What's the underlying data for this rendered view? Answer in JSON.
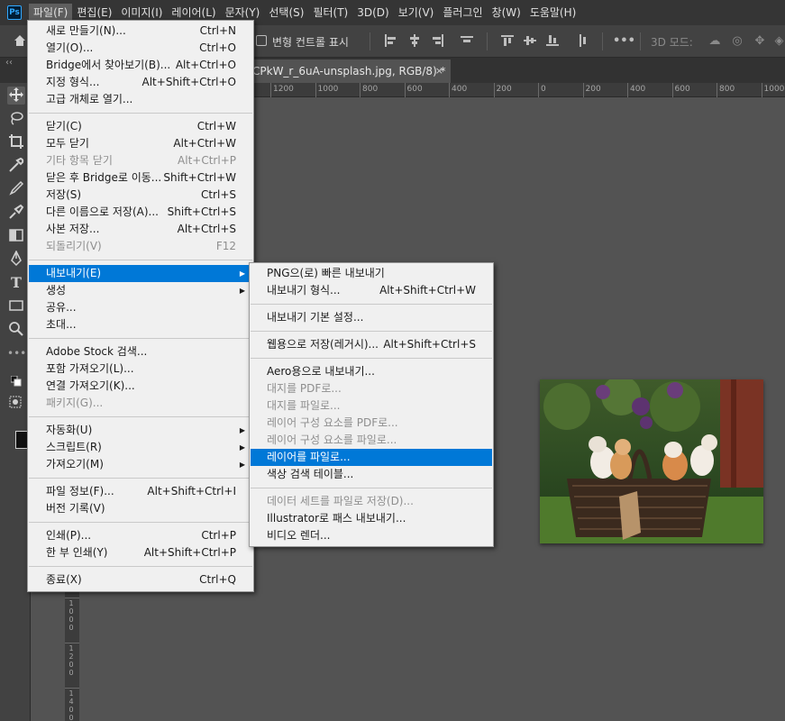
{
  "app": {
    "logo": "Ps"
  },
  "menubar": [
    {
      "label": "파일(F)",
      "active": true
    },
    {
      "label": "편집(E)"
    },
    {
      "label": "이미지(I)"
    },
    {
      "label": "레이어(L)"
    },
    {
      "label": "문자(Y)"
    },
    {
      "label": "선택(S)"
    },
    {
      "label": "필터(T)"
    },
    {
      "label": "3D(D)"
    },
    {
      "label": "보기(V)"
    },
    {
      "label": "플러그인"
    },
    {
      "label": "창(W)"
    },
    {
      "label": "도움말(H)"
    }
  ],
  "options_bar": {
    "transform_controls_label": "변형 컨트롤 표시",
    "mode_3d_label": "3D 모드:",
    "more_label": "•••"
  },
  "tab": {
    "title": "CPkW_r_6uA-unsplash.jpg, RGB/8) *",
    "close": "×"
  },
  "panel_collapse": "‹‹",
  "ruler_top": [
    "1200",
    "1000",
    "800",
    "600",
    "400",
    "200",
    "0",
    "200",
    "400",
    "600",
    "800",
    "1000"
  ],
  "ruler_left": [
    {
      "digits": [
        "1",
        "0",
        "0",
        "0"
      ]
    },
    {
      "digits": [
        "1",
        "2",
        "0",
        "0"
      ]
    },
    {
      "digits": [
        "1",
        "4",
        "0",
        "0"
      ]
    }
  ],
  "file_menu": [
    {
      "label": "새로 만들기(N)...",
      "shortcut": "Ctrl+N"
    },
    {
      "label": "열기(O)...",
      "shortcut": "Ctrl+O"
    },
    {
      "label": "Bridge에서 찾아보기(B)...",
      "shortcut": "Alt+Ctrl+O"
    },
    {
      "label": "지정 형식...",
      "shortcut": "Alt+Shift+Ctrl+O"
    },
    {
      "label": "고급 개체로 열기..."
    },
    {
      "sep": true
    },
    {
      "label": "닫기(C)",
      "shortcut": "Ctrl+W"
    },
    {
      "label": "모두 닫기",
      "shortcut": "Alt+Ctrl+W"
    },
    {
      "label": "기타 항목 닫기",
      "shortcut": "Alt+Ctrl+P",
      "disabled": true
    },
    {
      "label": "닫은 후 Bridge로 이동...",
      "shortcut": "Shift+Ctrl+W"
    },
    {
      "label": "저장(S)",
      "shortcut": "Ctrl+S"
    },
    {
      "label": "다른 이름으로 저장(A)...",
      "shortcut": "Shift+Ctrl+S"
    },
    {
      "label": "사본 저장...",
      "shortcut": "Alt+Ctrl+S"
    },
    {
      "label": "되돌리기(V)",
      "shortcut": "F12",
      "disabled": true
    },
    {
      "sep": true
    },
    {
      "label": "내보내기(E)",
      "submenu": true,
      "highlighted": true
    },
    {
      "label": "생성",
      "submenu": true
    },
    {
      "label": "공유..."
    },
    {
      "label": "초대..."
    },
    {
      "sep": true
    },
    {
      "label": "Adobe Stock 검색..."
    },
    {
      "label": "포함 가져오기(L)..."
    },
    {
      "label": "연결 가져오기(K)..."
    },
    {
      "label": "패키지(G)...",
      "disabled": true
    },
    {
      "sep": true
    },
    {
      "label": "자동화(U)",
      "submenu": true
    },
    {
      "label": "스크립트(R)",
      "submenu": true
    },
    {
      "label": "가져오기(M)",
      "submenu": true
    },
    {
      "sep": true
    },
    {
      "label": "파일 정보(F)...",
      "shortcut": "Alt+Shift+Ctrl+I"
    },
    {
      "label": "버전 기록(V)"
    },
    {
      "sep": true
    },
    {
      "label": "인쇄(P)...",
      "shortcut": "Ctrl+P"
    },
    {
      "label": "한 부 인쇄(Y)",
      "shortcut": "Alt+Shift+Ctrl+P"
    },
    {
      "sep": true
    },
    {
      "label": "종료(X)",
      "shortcut": "Ctrl+Q"
    }
  ],
  "export_menu": [
    {
      "label": "PNG으(로) 빠른 내보내기"
    },
    {
      "label": "내보내기 형식...",
      "shortcut": "Alt+Shift+Ctrl+W"
    },
    {
      "sep": true
    },
    {
      "label": "내보내기 기본 설정..."
    },
    {
      "sep": true
    },
    {
      "label": "웹용으로 저장(레거시)...",
      "shortcut": "Alt+Shift+Ctrl+S"
    },
    {
      "sep": true
    },
    {
      "label": "Aero용으로 내보내기..."
    },
    {
      "label": "대지를 PDF로...",
      "disabled": true
    },
    {
      "label": "대지를 파일로...",
      "disabled": true
    },
    {
      "label": "레이어 구성 요소를 PDF로...",
      "disabled": true
    },
    {
      "label": "레이어 구성 요소를 파일로...",
      "disabled": true
    },
    {
      "label": "레이어를 파일로...",
      "highlighted": true
    },
    {
      "label": "색상 검색 테이블..."
    },
    {
      "sep": true
    },
    {
      "label": "데이터 세트를 파일로 저장(D)...",
      "disabled": true
    },
    {
      "label": "Illustrator로 패스 내보내기..."
    },
    {
      "label": "비디오 렌더..."
    }
  ],
  "icons": {
    "move": "move-icon",
    "lasso": "lasso-icon",
    "crop": "crop-icon",
    "eyedropper": "eyedropper-icon",
    "brush": "brush-icon",
    "stamp": "stamp-icon",
    "gradient": "gradient-icon",
    "pen": "pen-icon",
    "type": "type-icon",
    "shape": "rectangle-icon",
    "zoom": "zoom-icon"
  },
  "colors": {
    "highlight": "#0078d7",
    "menu_bg": "#f0f0f0",
    "canvas_bg": "#535353"
  }
}
